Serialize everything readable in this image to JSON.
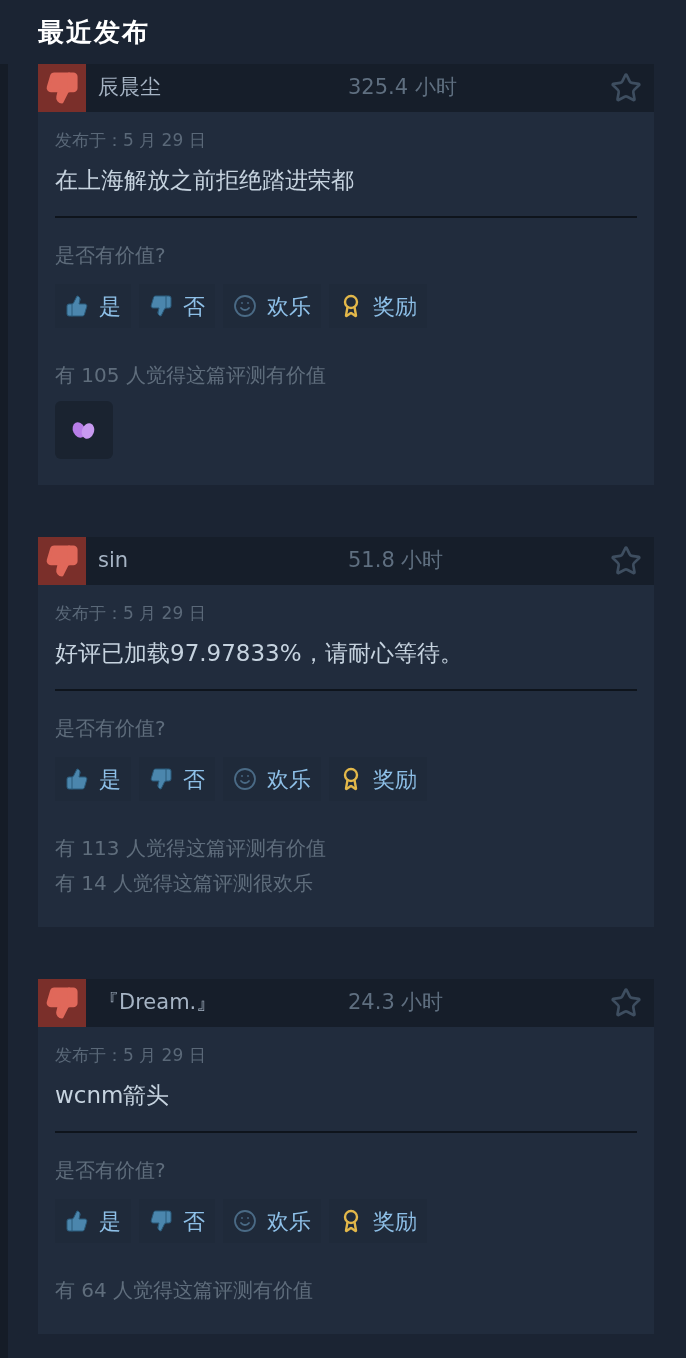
{
  "section_title": "最近发布",
  "reviews": [
    {
      "recommended": false,
      "author": "辰晨尘",
      "playtime": "325.4 小时",
      "posted": "发布于：5 月 29 日",
      "text": "在上海解放之前拒绝踏进荣都",
      "question": "是否有价值?",
      "actions": [
        {
          "kind": "yes",
          "label": "是"
        },
        {
          "kind": "no",
          "label": "否"
        },
        {
          "kind": "funny",
          "label": "欢乐"
        },
        {
          "kind": "award",
          "label": "奖励"
        }
      ],
      "stats": [
        "有 105 人觉得这篇评测有价值"
      ],
      "has_award_badge": true
    },
    {
      "recommended": false,
      "author": "sin",
      "playtime": "51.8 小时",
      "posted": "发布于：5 月 29 日",
      "text": "好评已加载97.97833%，请耐心等待。",
      "question": "是否有价值?",
      "actions": [
        {
          "kind": "yes",
          "label": "是"
        },
        {
          "kind": "no",
          "label": "否"
        },
        {
          "kind": "funny",
          "label": "欢乐"
        },
        {
          "kind": "award",
          "label": "奖励"
        }
      ],
      "stats": [
        "有 113 人觉得这篇评测有价值",
        "有 14 人觉得这篇评测很欢乐"
      ],
      "has_award_badge": false
    },
    {
      "recommended": false,
      "author": "『Dream.』",
      "playtime": "24.3 小时",
      "posted": "发布于：5 月 29 日",
      "text": "wcnm箭头",
      "question": "是否有价值?",
      "actions": [
        {
          "kind": "yes",
          "label": "是"
        },
        {
          "kind": "no",
          "label": "否"
        },
        {
          "kind": "funny",
          "label": "欢乐"
        },
        {
          "kind": "award",
          "label": "奖励"
        }
      ],
      "stats": [
        "有 64 人觉得这篇评测有价值"
      ],
      "has_award_badge": false
    }
  ]
}
